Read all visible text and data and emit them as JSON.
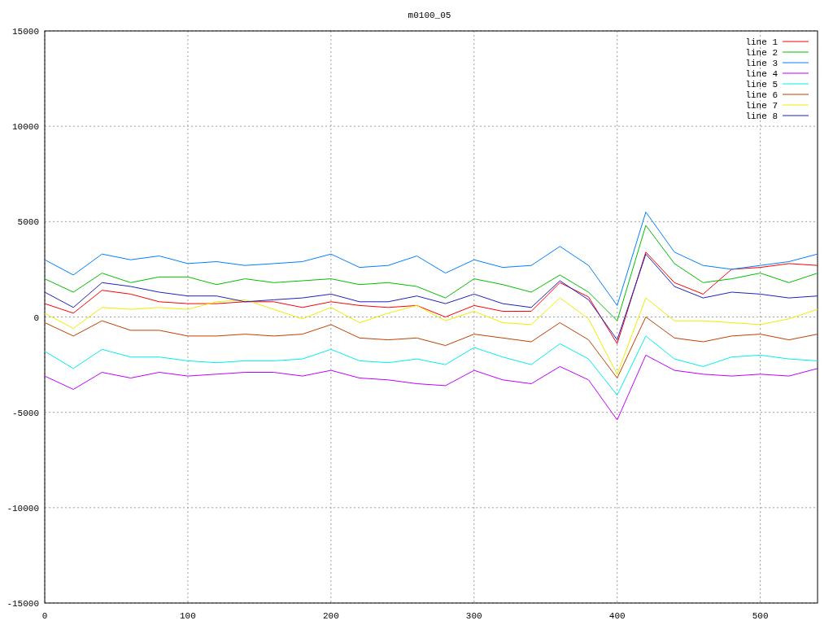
{
  "chart_data": {
    "type": "line",
    "title": "m0100_05",
    "x": [
      0,
      20,
      40,
      60,
      80,
      100,
      120,
      140,
      160,
      180,
      200,
      220,
      240,
      260,
      280,
      300,
      320,
      340,
      360,
      380,
      400,
      420,
      440,
      460,
      480,
      500,
      520,
      540
    ],
    "xlim": [
      0,
      540
    ],
    "ylim": [
      -15000,
      15000
    ],
    "xticks": [
      0,
      100,
      200,
      300,
      400,
      500
    ],
    "yticks": [
      -15000,
      -10000,
      -5000,
      0,
      5000,
      10000,
      15000
    ],
    "grid": true,
    "legend": true,
    "series": [
      {
        "name": "line 1",
        "color": "#ff0000",
        "values": [
          700,
          200,
          1400,
          1200,
          800,
          700,
          700,
          800,
          800,
          500,
          800,
          600,
          500,
          600,
          0,
          600,
          300,
          300,
          1800,
          1050,
          -1400,
          3400,
          1800,
          1200,
          2500,
          2600,
          2800,
          2700
        ]
      },
      {
        "name": "line 2",
        "color": "#00c000",
        "values": [
          2000,
          1300,
          2300,
          1800,
          2100,
          2100,
          1700,
          2000,
          1800,
          1900,
          2000,
          1700,
          1800,
          1600,
          1000,
          2000,
          1700,
          1300,
          2200,
          1300,
          -200,
          4800,
          2800,
          1800,
          2000,
          2300,
          1800,
          2300
        ]
      },
      {
        "name": "line 3",
        "color": "#0080ff",
        "values": [
          3000,
          2200,
          3300,
          3000,
          3200,
          2800,
          2900,
          2700,
          2800,
          2900,
          3300,
          2600,
          2700,
          3200,
          2300,
          3000,
          2600,
          2700,
          3700,
          2700,
          600,
          5500,
          3400,
          2700,
          2500,
          2700,
          2900,
          3300
        ]
      },
      {
        "name": "line 4",
        "color": "#c000ff",
        "values": [
          -3100,
          -3800,
          -2900,
          -3200,
          -2900,
          -3100,
          -3000,
          -2900,
          -2900,
          -3100,
          -2800,
          -3200,
          -3300,
          -3500,
          -3600,
          -2800,
          -3300,
          -3500,
          -2600,
          -3300,
          -5400,
          -2000,
          -2800,
          -3000,
          -3100,
          -3000,
          -3100,
          -2700
        ]
      },
      {
        "name": "line 5",
        "color": "#00eeee",
        "values": [
          -1800,
          -2700,
          -1700,
          -2100,
          -2100,
          -2300,
          -2400,
          -2300,
          -2300,
          -2200,
          -1700,
          -2300,
          -2400,
          -2200,
          -2500,
          -1600,
          -2100,
          -2500,
          -1400,
          -2200,
          -4100,
          -1000,
          -2200,
          -2600,
          -2100,
          -2000,
          -2200,
          -2300
        ]
      },
      {
        "name": "line 6",
        "color": "#c04000",
        "values": [
          -300,
          -1000,
          -200,
          -700,
          -700,
          -1000,
          -1000,
          -900,
          -1000,
          -900,
          -400,
          -1100,
          -1200,
          -1100,
          -1500,
          -900,
          -1100,
          -1300,
          -300,
          -1200,
          -3200,
          0,
          -1100,
          -1300,
          -1000,
          -900,
          -1200,
          -900
        ]
      },
      {
        "name": "line 7",
        "color": "#eeee00",
        "values": [
          200,
          -600,
          500,
          400,
          500,
          400,
          800,
          900,
          400,
          -100,
          500,
          -300,
          200,
          600,
          -200,
          300,
          -300,
          -400,
          1000,
          -100,
          -3000,
          1000,
          -200,
          -200,
          -300,
          -400,
          -100,
          400
        ]
      },
      {
        "name": "line 8",
        "color": "#2020c0",
        "values": [
          1300,
          500,
          1800,
          1600,
          1300,
          1100,
          1100,
          800,
          900,
          1000,
          1200,
          800,
          800,
          1100,
          700,
          1200,
          700,
          500,
          1900,
          900,
          -1200,
          3300,
          1600,
          1000,
          1300,
          1200,
          1000,
          1100
        ]
      }
    ]
  }
}
